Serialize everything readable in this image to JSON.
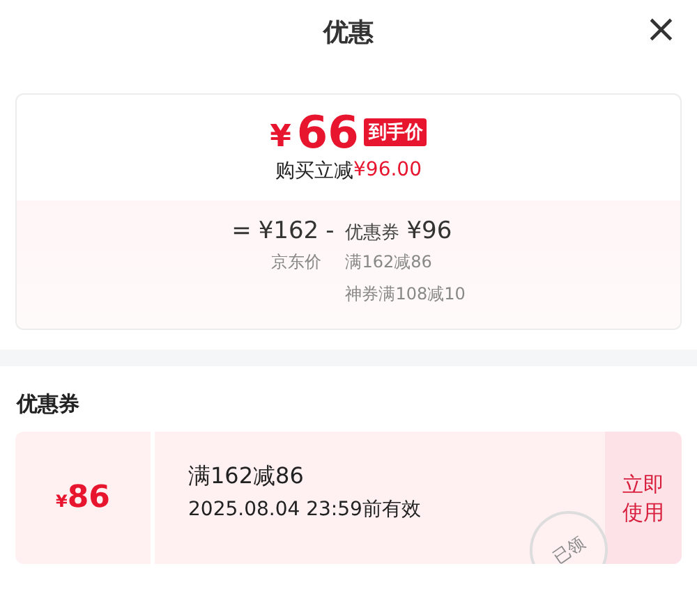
{
  "header": {
    "title": "优惠",
    "close": "×"
  },
  "price_card": {
    "currency": "¥",
    "price": "66",
    "badge": "到手价",
    "saving_label": "购买立减",
    "saving_amount": "¥96.00",
    "formula": {
      "equals": "=",
      "base_price": "¥162",
      "minus": "-",
      "coupon_label": "优惠券",
      "coupon_amount": "¥96"
    },
    "base_note": "京东价",
    "coupon_notes": [
      "满162减86",
      "神券满108减10"
    ]
  },
  "coupon_section": {
    "title": "优惠券",
    "coupons": [
      {
        "currency": "¥",
        "amount": "86",
        "title": "满162减86",
        "validity": "2025.08.04 23:59前有效",
        "action": "立即使用",
        "stamp": "已领"
      }
    ]
  }
}
